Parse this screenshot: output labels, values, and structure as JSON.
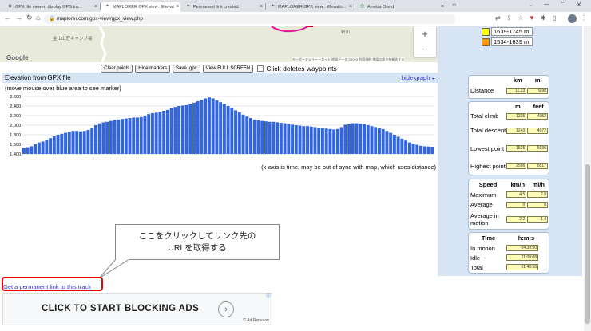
{
  "browser": {
    "tabs": [
      {
        "title": "GPX file viewer: display GPS tra...",
        "active": false
      },
      {
        "title": "MAPLORER GPX view : Elevation...",
        "active": true
      },
      {
        "title": "Permanent link created",
        "active": false
      },
      {
        "title": "MAPLORER GPX view : Elevatio...",
        "active": false
      },
      {
        "title": "Ameba Ownd",
        "active": false
      }
    ],
    "url": "maplorer.com/gpx-view/gpx_view.php"
  },
  "map": {
    "labels": [
      "金山山荘キャンプ場",
      "釈山"
    ],
    "google_logo": "Google",
    "zoom_in": "+",
    "zoom_out": "−",
    "attribution": "キーボードショートカット  地図データ ©2023  利用規約  地図の誤りを報告する"
  },
  "controls": {
    "clear_points": "Clear points",
    "hide_markers": "Hide markers",
    "save_gpx": "Save .gpx",
    "full_screen": "View FULL SCREEN",
    "click_deletes": "Click deletes waypoints"
  },
  "legend": [
    {
      "label": "1639-1745 m",
      "color": "#ffff00"
    },
    {
      "label": "1534-1639 m",
      "color": "#ff9900"
    }
  ],
  "elevation": {
    "header": "Elevation from GPX file",
    "hide_graph": "hide graph",
    "hint": "(move mouse over blue area to see marker)",
    "xnote": "(x-axis is time; may be out of sync with map, which uses distance)"
  },
  "chart_data": {
    "type": "bar",
    "bar_color": "#3366dd",
    "ylim": [
      1400,
      2600
    ],
    "yticks": [
      1400,
      1600,
      1800,
      2000,
      2200,
      2400,
      2600
    ],
    "ytick_labels": [
      "1,400",
      "1,600",
      "1,800",
      "2,000",
      "2,200",
      "2,400",
      "2,600"
    ],
    "values": [
      1530,
      1540,
      1560,
      1600,
      1640,
      1660,
      1690,
      1730,
      1770,
      1800,
      1820,
      1840,
      1860,
      1880,
      1880,
      1870,
      1880,
      1900,
      1950,
      2000,
      2040,
      2060,
      2070,
      2090,
      2110,
      2120,
      2130,
      2140,
      2150,
      2160,
      2160,
      2170,
      2200,
      2230,
      2250,
      2260,
      2280,
      2300,
      2320,
      2350,
      2380,
      2400,
      2410,
      2420,
      2440,
      2470,
      2500,
      2530,
      2560,
      2580,
      2560,
      2520,
      2480,
      2440,
      2400,
      2360,
      2310,
      2270,
      2220,
      2180,
      2150,
      2120,
      2100,
      2090,
      2080,
      2070,
      2070,
      2060,
      2050,
      2040,
      2030,
      2010,
      2000,
      1990,
      1980,
      1980,
      1970,
      1960,
      1950,
      1940,
      1930,
      1920,
      1910,
      1920,
      1960,
      2010,
      2030,
      2040,
      2040,
      2030,
      2020,
      2000,
      1980,
      1960,
      1940,
      1920,
      1880,
      1840,
      1800,
      1760,
      1720,
      1680,
      1640,
      1610,
      1590,
      1570,
      1560,
      1555,
      1550
    ]
  },
  "stats": {
    "distance": {
      "headers": [
        "km",
        "mi"
      ],
      "rows": [
        {
          "label": "Distance",
          "values": [
            "11.23",
            "6.98"
          ]
        }
      ]
    },
    "climb": {
      "headers": [
        "m",
        "feet"
      ],
      "rows": [
        {
          "label": "Total climb",
          "values": [
            "1235",
            "4052"
          ]
        },
        {
          "label": "Total descent",
          "values": [
            "1240",
            "4072"
          ]
        },
        {
          "label": "Lowest point",
          "values": [
            "1535",
            "5036"
          ]
        },
        {
          "label": "Highest point",
          "values": [
            "2596",
            "8517"
          ]
        }
      ]
    },
    "speed": {
      "title": "Speed",
      "headers": [
        "km/h",
        "mi/h"
      ],
      "rows": [
        {
          "label": "Maximum",
          "values": [
            "4.5",
            "2.8"
          ]
        },
        {
          "label": "Average",
          "values": [
            "0",
            "0"
          ]
        },
        {
          "label": "Average in motion",
          "values": [
            "2.2",
            "1.4"
          ]
        }
      ]
    },
    "time": {
      "title": "Time",
      "headers": [
        "h:m:s"
      ],
      "rows": [
        {
          "label": "In motion",
          "values": [
            "04:39:50"
          ]
        },
        {
          "label": "Idle",
          "values": [
            "21:08:08"
          ]
        },
        {
          "label": "Total",
          "values": [
            "01:48:58"
          ]
        }
      ]
    }
  },
  "permalink": "Get a permanent link to this track",
  "callout": {
    "line1": "ここをクリックしてリンク先の",
    "line2": "URLを取得する"
  },
  "ad": {
    "text": "CLICK TO START BLOCKING ADS",
    "remover": "Ad Remover"
  }
}
